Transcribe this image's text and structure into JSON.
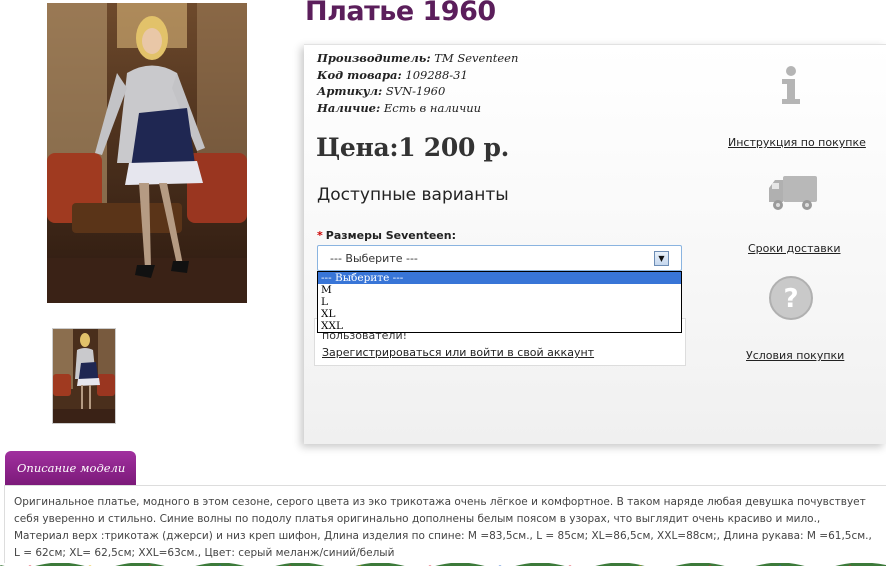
{
  "product": {
    "title": "Платье 1960",
    "meta": [
      {
        "label": "Производитель:",
        "value": " TM Seventeen"
      },
      {
        "label": "Код товара:",
        "value": " 109288-31"
      },
      {
        "label": "Артикул:",
        "value": " SVN-1960"
      },
      {
        "label": "Наличие:",
        "value": " Есть в наличии"
      }
    ],
    "price": "Цена:1 200 р."
  },
  "options": {
    "heading": "Доступные варианты",
    "required_mark": "*",
    "size_label": "Размеры Seventeen:",
    "select_value": "--- Выберите ---",
    "dropdown_options": [
      "--- Выберите ---",
      "M",
      "L",
      "XL",
      "XXL"
    ]
  },
  "notice": {
    "text": "пользователи!",
    "link": "Зарегистрироваться или войти в свой аккаунт"
  },
  "side": {
    "instruction_link": "Инструкция по покупке",
    "delivery_link": "Сроки доставки",
    "conditions_link": "Условия покупки"
  },
  "description": {
    "tab_label": "Описание модели",
    "text": "Оригинальное платье, модного в этом сезоне, серого цвета из эко трикотажа очень лёгкое и комфортное. В таком наряде любая девушка почувствует себя уверенно и стильно. Синие волны по подолу платья оригинально дополнены белым поясом в узорах, что выглядит очень красиво и мило., Материал верх :трикотаж (джерси) и низ креп шифон, Длина изделия по спине: M =83,5см., L = 85см; XL=86,5см, XXL=88см;, Длина рукава: M =61,5см., L = 62см; XL= 62,5см; XXL=63см., Цвет: серый меланж/синий/белый"
  },
  "colors": {
    "title": "#5b1e5b",
    "tab": "#8b2189",
    "select_highlight": "#3875d7"
  }
}
